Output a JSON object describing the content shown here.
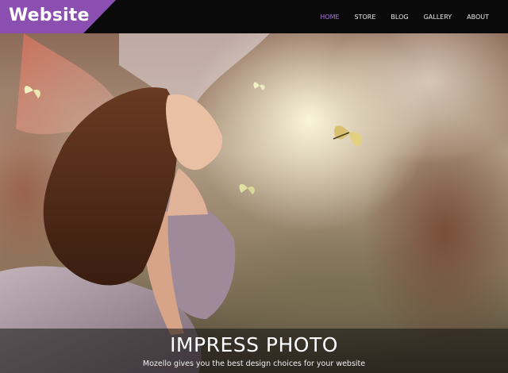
{
  "header": {
    "logo_text": "Website",
    "nav": [
      {
        "label": "HOME",
        "active": true
      },
      {
        "label": "STORE",
        "active": false
      },
      {
        "label": "BLOG",
        "active": false
      },
      {
        "label": "GALLERY",
        "active": false
      },
      {
        "label": "ABOUT",
        "active": false
      }
    ]
  },
  "hero": {
    "title": "IMPRESS PHOTO",
    "subtitle": "Mozello gives you the best design choices for your website"
  },
  "colors": {
    "accent": "#8a4fb0",
    "nav_active": "#a77ad6",
    "header_bg": "#0a0a0a"
  }
}
